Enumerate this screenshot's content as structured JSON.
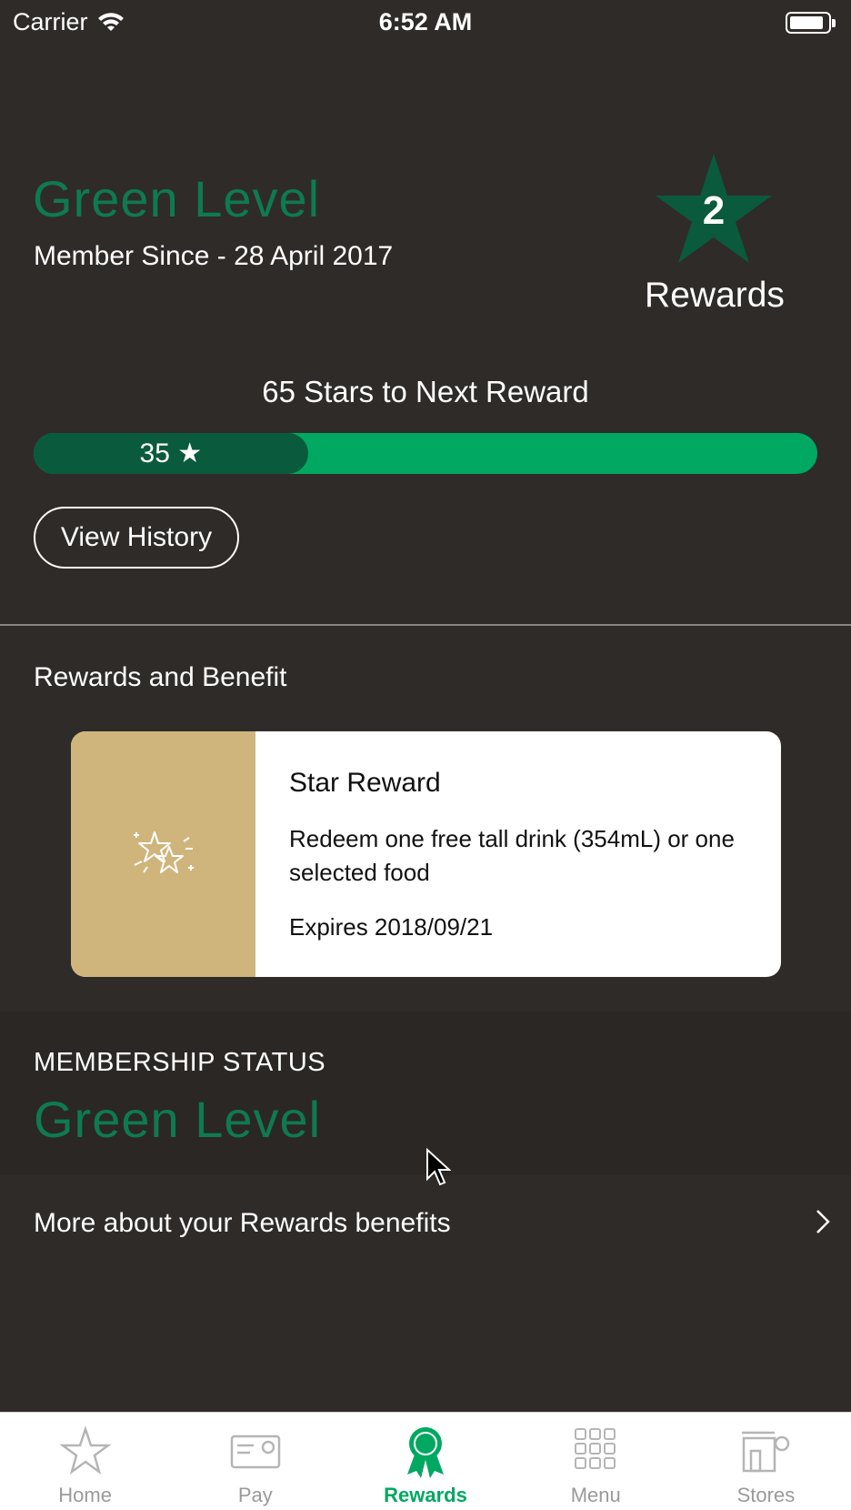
{
  "status_bar": {
    "carrier": "Carrier",
    "time": "6:52 AM"
  },
  "header": {
    "level": "Green Level",
    "member_since": "Member Since - 28 April 2017",
    "rewards_count": "2",
    "rewards_label": "Rewards"
  },
  "progress": {
    "label": "65 Stars to Next Reward",
    "stars_text": "35 ★",
    "fraction": 0.35
  },
  "history_button": "View History",
  "rewards_section": {
    "heading": "Rewards and Benefit",
    "card": {
      "title": "Star Reward",
      "description": "Redeem one free tall drink (354mL) or one selected food",
      "expires": "Expires 2018/09/21"
    }
  },
  "membership": {
    "label": "MEMBERSHIP STATUS",
    "level": "Green Level"
  },
  "more_link": "More about your Rewards benefits",
  "tabs": [
    {
      "label": "Home",
      "icon": "star-icon",
      "active": false
    },
    {
      "label": "Pay",
      "icon": "card-icon",
      "active": false
    },
    {
      "label": "Rewards",
      "icon": "ribbon-icon",
      "active": true
    },
    {
      "label": "Menu",
      "icon": "grid-icon",
      "active": false
    },
    {
      "label": "Stores",
      "icon": "store-icon",
      "active": false
    }
  ],
  "colors": {
    "background": "#2f2b29",
    "accent_green": "#00a862",
    "dark_green": "#0a5a3e",
    "level_green": "#0e7a52",
    "card_gold": "#cfb57c"
  }
}
